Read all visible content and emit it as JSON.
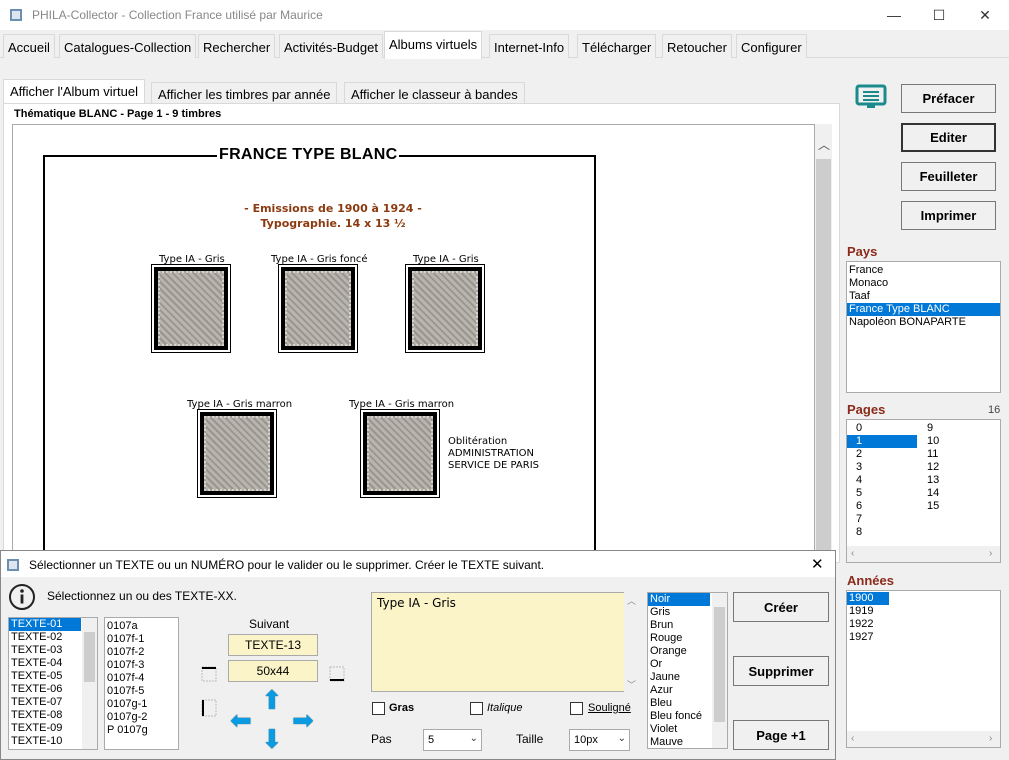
{
  "window": {
    "title": "PHILA-Collector - Collection France utilisé par Maurice",
    "minimize": "—",
    "maximize": "☐",
    "close": "✕"
  },
  "menu_tabs": [
    "Accueil",
    "Catalogues-Collection",
    "Rechercher",
    "Activités-Budget",
    "Albums virtuels",
    "Internet-Info",
    "Télécharger",
    "Retoucher",
    "Configurer"
  ],
  "sub_tabs": [
    "Afficher l'Album virtuel",
    "Afficher les timbres par année",
    "Afficher le classeur à bandes"
  ],
  "page_info": "Thématique BLANC - Page 1 - 9 timbres",
  "album": {
    "title": "FRANCE TYPE BLANC",
    "emission_line1": "- Emissions de 1900 à 1924 -",
    "emission_line2": "Typographie. 14 x 13 ½",
    "stamps": [
      {
        "label": "Type IA - Gris"
      },
      {
        "label": "Type IA - Gris foncé"
      },
      {
        "label": "Type IA - Gris"
      },
      {
        "label": "Type IA - Gris marron"
      },
      {
        "label": "Type IA - Gris marron"
      }
    ],
    "oblit_line1": "Oblitération",
    "oblit_line2": "ADMINISTRATION",
    "oblit_line3": "SERVICE DE PARIS"
  },
  "right_buttons": {
    "prefacer": "Préfacer",
    "editer": "Editer",
    "feuilleter": "Feuilleter",
    "imprimer": "Imprimer"
  },
  "pays": {
    "label": "Pays",
    "items": [
      "France",
      "Monaco",
      "Taaf",
      "France Type BLANC",
      "Napoléon BONAPARTE"
    ],
    "selected": 3
  },
  "pages": {
    "label": "Pages",
    "count": "16",
    "col1": [
      "0",
      "1",
      "2",
      "3",
      "4",
      "5",
      "6",
      "7",
      "8"
    ],
    "col2": [
      "9",
      "10",
      "11",
      "12",
      "13",
      "14",
      "15"
    ],
    "selected": "1"
  },
  "annees": {
    "label": "Années",
    "items": [
      "1900",
      "1919",
      "1922",
      "1927"
    ],
    "selected": 0
  },
  "dialog": {
    "title": "Sélectionner un TEXTE ou un NUMÉRO pour le valider ou le supprimer. Créer le TEXTE suivant.",
    "info": "Sélectionnez un ou des TEXTE-XX.",
    "textes": [
      "TEXTE-01",
      "TEXTE-02",
      "TEXTE-03",
      "TEXTE-04",
      "TEXTE-05",
      "TEXTE-06",
      "TEXTE-07",
      "TEXTE-08",
      "TEXTE-09",
      "TEXTE-10"
    ],
    "numeros": [
      "0107a",
      "0107f-1",
      "0107f-2",
      "0107f-3",
      "0107f-4",
      "0107f-5",
      "0107g-1",
      "0107g-2",
      "P 0107g"
    ],
    "suivant_label": "Suivant",
    "suivant_value": "TEXTE-13",
    "size_value": "50x44",
    "text_content": "Type IA - Gris",
    "gras": "Gras",
    "italique": "Italique",
    "souligne": "Souligné",
    "pas_label": "Pas",
    "pas_value": "5",
    "taille_label": "Taille",
    "taille_value": "10px",
    "colors": [
      "Noir",
      "Gris",
      "Brun",
      "Rouge",
      "Orange",
      "Or",
      "Jaune",
      "Azur",
      "Bleu",
      "Bleu foncé",
      "Violet",
      "Mauve"
    ],
    "creer": "Créer",
    "supprimer": "Supprimer",
    "page_plus": "Page +1"
  }
}
